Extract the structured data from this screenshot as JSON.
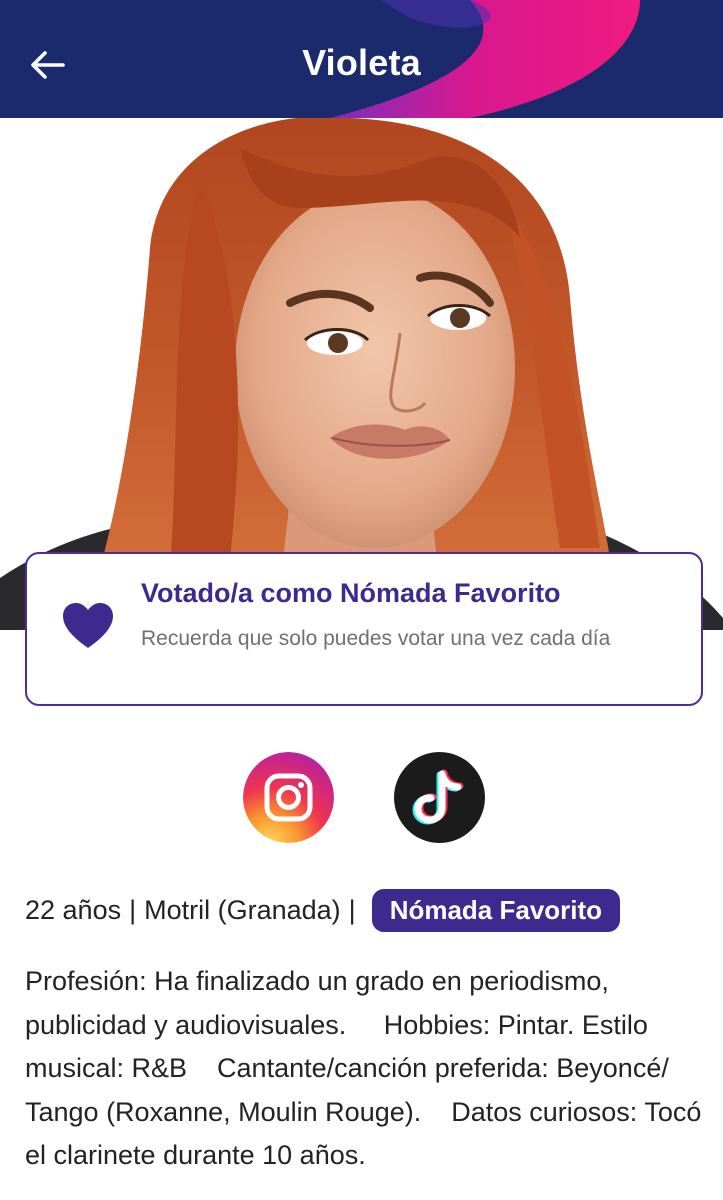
{
  "header": {
    "title": "Violeta",
    "back_icon": "arrow-left-icon",
    "background": "#1b2a6d",
    "accent": "#e5158c"
  },
  "vote_card": {
    "title": "Votado/a como Nómada Favorito",
    "subtitle": "Recuerda que solo puedes votar una vez cada día",
    "icon": "heart-icon",
    "accent": "#3d2a8f"
  },
  "social": {
    "instagram_icon": "instagram-icon",
    "tiktok_icon": "tiktok-icon"
  },
  "profile": {
    "age": "22 años",
    "location": "Motril (Granada)",
    "separator": "|",
    "badge": "Nómada Favorito",
    "bio": "Profesión: Ha finalizado un grado en periodismo, publicidad y audiovisuales.     Hobbies: Pintar. Estilo musical: R&B    Cantante/canción preferida: Beyoncé/ Tango (Roxanne, Moulin Rouge).    Datos curiosos: Tocó el clarinete durante 10 años."
  }
}
